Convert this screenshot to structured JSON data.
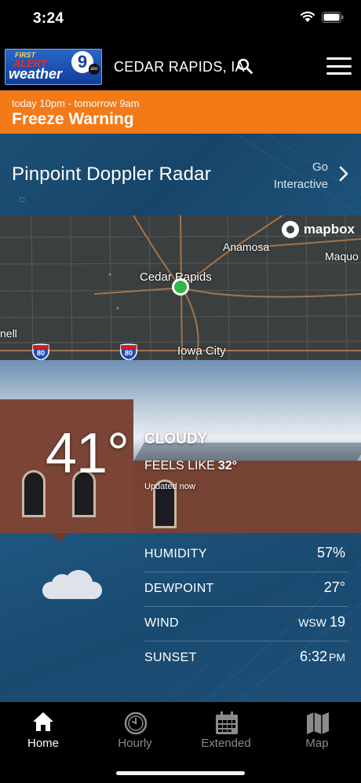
{
  "status_bar": {
    "time": "3:24"
  },
  "header": {
    "logo": {
      "first": "FIRST",
      "alert": "ALERT",
      "weather": "weather",
      "channel": "9",
      "network": "abc"
    },
    "location": "CEDAR RAPIDS, IA"
  },
  "alert": {
    "time": "today 10pm - tomorrow 9am",
    "title": "Freeze Warning",
    "color": "#f47a18"
  },
  "radar": {
    "title": "Pinpoint Doppler Radar",
    "go_line1": "Go",
    "go_line2": "Interactive"
  },
  "map": {
    "attribution": "mapbox",
    "cities": [
      "Cedar Rapids",
      "Anamosa",
      "Maquo",
      "Iowa City",
      "nell"
    ],
    "highway_1": "80",
    "highway_2": "80"
  },
  "current": {
    "temperature": "41°",
    "condition": "CLOUDY",
    "feels_like_label": "FEELS LIKE",
    "feels_like_value": "32°",
    "updated": "Updated now"
  },
  "details": [
    {
      "label": "HUMIDITY",
      "value": "57%",
      "unit": ""
    },
    {
      "label": "DEWPOINT",
      "value": "27°",
      "unit": ""
    },
    {
      "label": "WIND",
      "value": "19",
      "unit": "WSW"
    },
    {
      "label": "SUNSET",
      "value": "6:32",
      "unit": "PM"
    }
  ],
  "tabs": [
    {
      "label": "Home",
      "icon": "home-icon",
      "active": true
    },
    {
      "label": "Hourly",
      "icon": "clock-icon",
      "active": false
    },
    {
      "label": "Extended",
      "icon": "calendar-icon",
      "active": false
    },
    {
      "label": "Map",
      "icon": "map-icon",
      "active": false
    }
  ]
}
